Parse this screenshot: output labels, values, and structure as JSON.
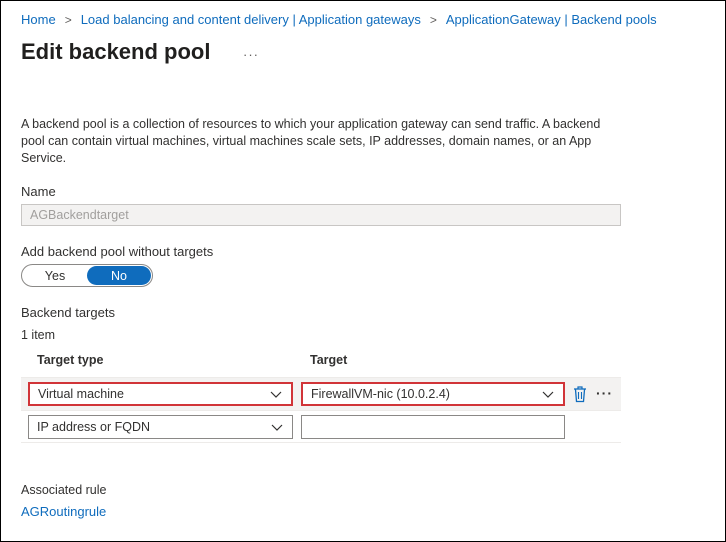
{
  "breadcrumb": [
    {
      "label": "Home"
    },
    {
      "label": "Load balancing and content delivery | Application gateways"
    },
    {
      "label": "ApplicationGateway | Backend pools"
    }
  ],
  "breadcrumb_separator": ">",
  "page": {
    "title": "Edit backend pool",
    "more_label": "···"
  },
  "description": "A backend pool is a collection of resources to which your application gateway can send traffic. A backend pool can contain virtual machines, virtual machines scale sets, IP addresses, domain names, or an App Service.",
  "name_field": {
    "label": "Name",
    "value": "AGBackendtarget"
  },
  "without_targets": {
    "label": "Add backend pool without targets",
    "options": [
      "Yes",
      "No"
    ],
    "selected": "No"
  },
  "backend_targets": {
    "label": "Backend targets",
    "count": "1 item",
    "columns": [
      "Target type",
      "Target"
    ],
    "rows": [
      {
        "type": "Virtual machine",
        "target": "FirewallVM-nic (10.0.2.4)"
      },
      {
        "type": "IP address or FQDN",
        "target": ""
      }
    ],
    "row_more_label": "···"
  },
  "associated_rule": {
    "label": "Associated rule",
    "value": "AGRoutingrule"
  },
  "colors": {
    "accent": "#0f6cbd",
    "highlight": "#d13438",
    "delete_icon": "#0f6cbd"
  }
}
